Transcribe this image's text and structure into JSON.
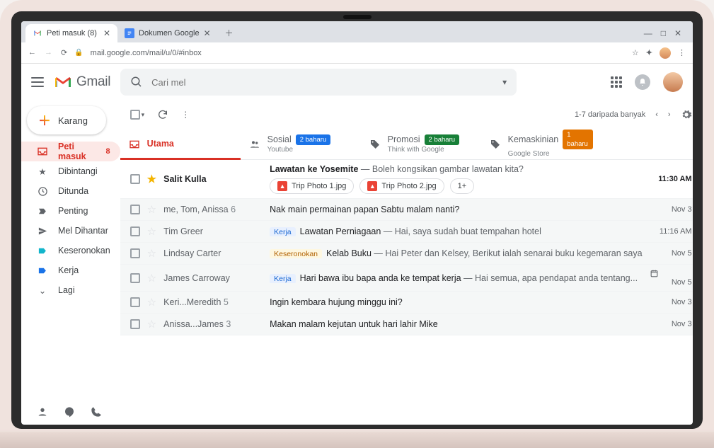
{
  "browser": {
    "tabs": [
      {
        "title": "Peti masuk (8)",
        "active": true,
        "icon": "gmail"
      },
      {
        "title": "Dokumen Google",
        "active": false,
        "icon": "docs"
      }
    ],
    "url": "mail.google.com/mail/u/0/#inbox"
  },
  "header": {
    "product": "Gmail",
    "search_placeholder": "Cari mel"
  },
  "compose_label": "Karang",
  "sidebar": [
    {
      "icon": "inbox",
      "label": "Peti masuk",
      "count": "8",
      "active": true
    },
    {
      "icon": "star",
      "label": "Dibintangi"
    },
    {
      "icon": "clock",
      "label": "Ditunda"
    },
    {
      "icon": "flag",
      "label": "Penting"
    },
    {
      "icon": "send",
      "label": "Mel Dihantar"
    },
    {
      "icon": "tagteal",
      "label": "Keseronokan"
    },
    {
      "icon": "tagblue",
      "label": "Kerja"
    },
    {
      "icon": "more",
      "label": "Lagi"
    }
  ],
  "toolbar": {
    "range": "1-7 daripada banyak"
  },
  "category_tabs": [
    {
      "name": "Utama",
      "sub": "",
      "badge": null,
      "active": true,
      "icon": "inbox"
    },
    {
      "name": "Sosial",
      "sub": "Youtube",
      "badge": "2 baharu",
      "badge_color": "blue",
      "icon": "people"
    },
    {
      "name": "Promosi",
      "sub": "Think with Google",
      "badge": "2 baharu",
      "badge_color": "green",
      "icon": "tag"
    },
    {
      "name": "Kemaskinian",
      "sub": "Google Store",
      "badge": "1 baharu",
      "badge_color": "orange",
      "icon": "info"
    }
  ],
  "emails": [
    {
      "unread": true,
      "starred": true,
      "sender": "Salit Kulla",
      "subject": "Lawatan ke Yosemite",
      "snippet": "Boleh kongsikan gambar lawatan kita?",
      "date": "11:30 AM",
      "attachments": [
        "Trip Photo 1.jpg",
        "Trip Photo 2.jpg"
      ],
      "attach_more": "1+"
    },
    {
      "unread": false,
      "starred": false,
      "sender": "me, Tom, Anissa",
      "thread": "6",
      "subject": "Nak main permainan papan Sabtu malam nanti?",
      "snippet": "",
      "date": "Nov 3"
    },
    {
      "unread": false,
      "starred": false,
      "sender": "Tim Greer",
      "label": {
        "text": "Kerja",
        "cls": "work"
      },
      "subject": "Lawatan Perniagaan",
      "snippet": "Hai, saya sudah buat tempahan hotel",
      "date": "11:16 AM"
    },
    {
      "unread": false,
      "starred": false,
      "sender": "Lindsay Carter",
      "label": {
        "text": "Keseronokan",
        "cls": "fun"
      },
      "subject": "Kelab Buku",
      "snippet": "Hai Peter dan Kelsey, Berikut ialah senarai buku kegemaran saya",
      "date": "Nov 5"
    },
    {
      "unread": false,
      "starred": false,
      "sender": "James Carroway",
      "label": {
        "text": "Kerja",
        "cls": "work"
      },
      "subject": "Hari bawa ibu bapa anda ke tempat kerja",
      "snippet": "Hai semua, apa pendapat anda tentang...",
      "date": "Nov 5",
      "has_event": true
    },
    {
      "unread": false,
      "starred": false,
      "sender": "Keri...Meredith",
      "thread": "5",
      "subject": "Ingin kembara hujung minggu ini?",
      "snippet": "",
      "date": "Nov 3"
    },
    {
      "unread": false,
      "starred": false,
      "sender": "Anissa...James",
      "thread": "3",
      "subject": "Makan malam kejutan untuk hari lahir Mike",
      "snippet": "",
      "date": "Nov 3"
    }
  ]
}
